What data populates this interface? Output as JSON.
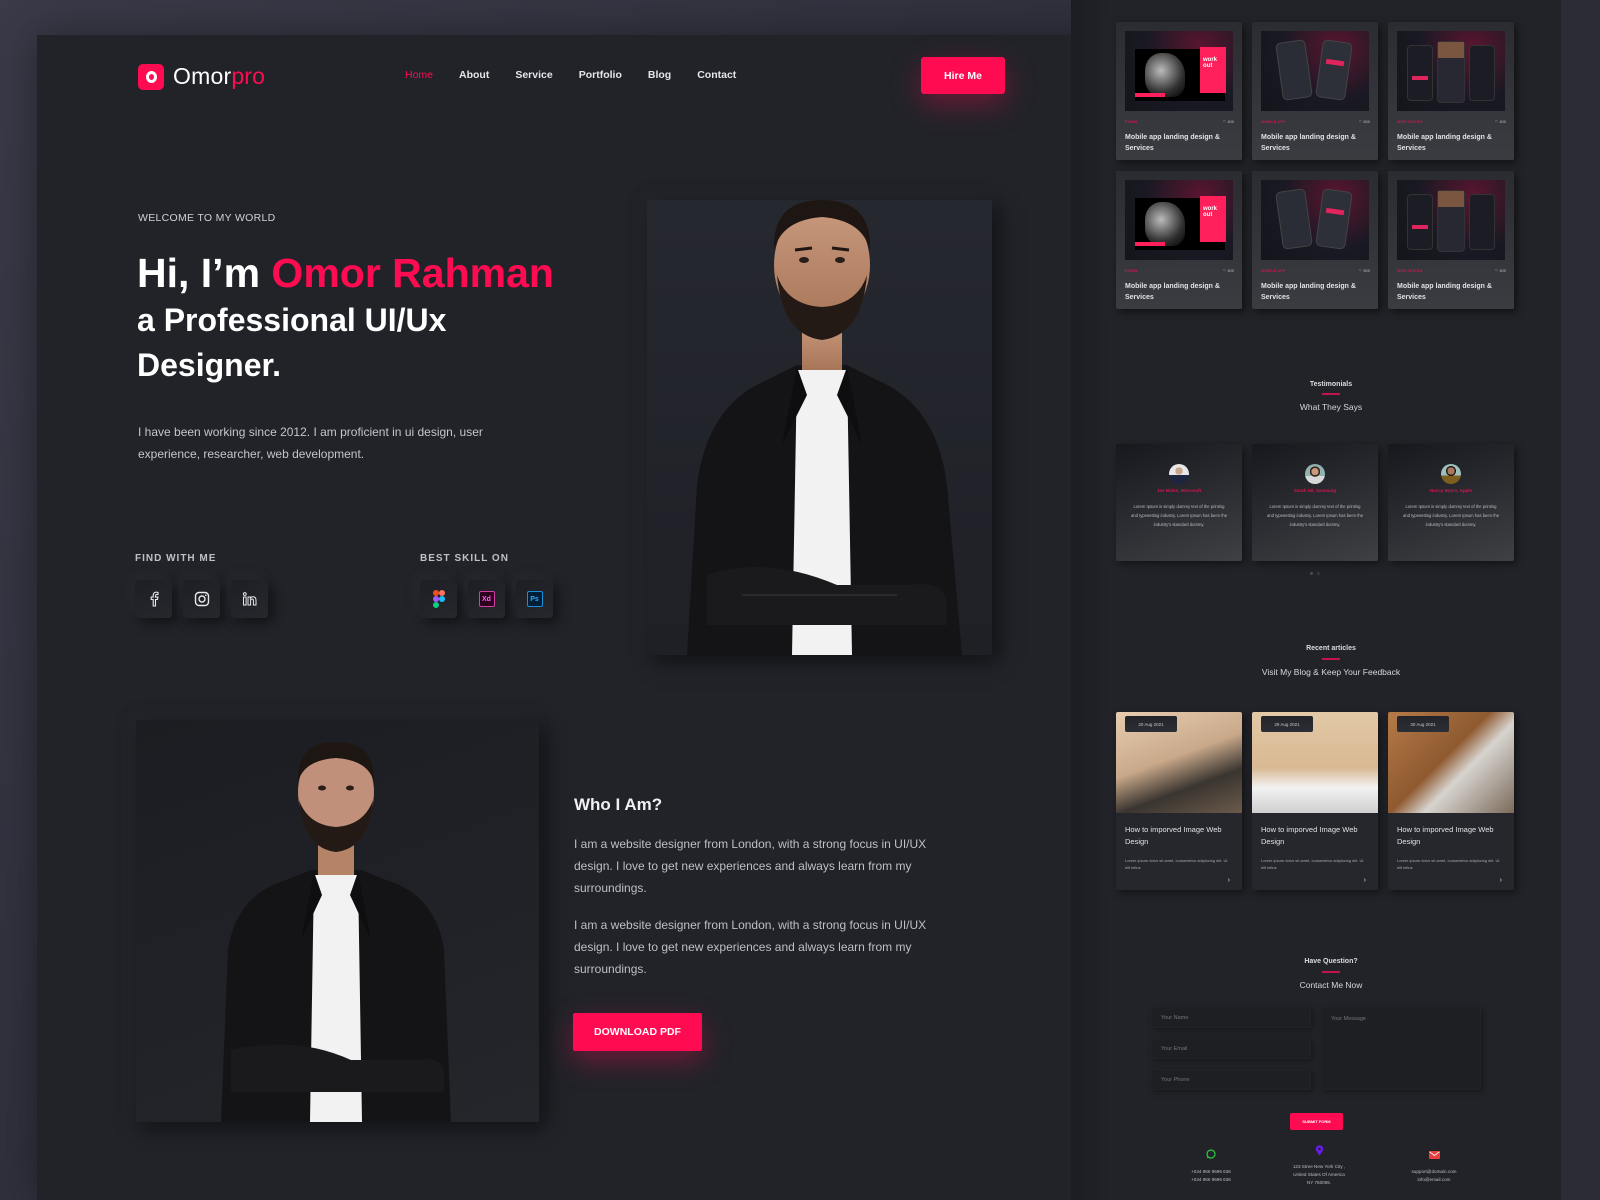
{
  "colors": {
    "accent": "#ff0b52",
    "bg": "#212329",
    "text": "#ffffff",
    "muted": "#c5c5cc"
  },
  "nav": {
    "logo_main": "Omor",
    "logo_accent": "pro",
    "items": [
      {
        "label": "Home",
        "active": true
      },
      {
        "label": "About",
        "active": false
      },
      {
        "label": "Service",
        "active": false
      },
      {
        "label": "Portfolio",
        "active": false
      },
      {
        "label": "Blog",
        "active": false
      },
      {
        "label": "Contact",
        "active": false
      }
    ],
    "hire_label": "Hire Me"
  },
  "hero": {
    "welcome": "WELCOME TO MY WORLD",
    "greeting": "Hi, I’m ",
    "name": "Omor Rahman",
    "role_line1": "a Professional UI/Ux",
    "role_line2": "Designer.",
    "description": "I have been working since 2012. I am proficient in ui design, user experience, researcher, web development.",
    "find_label": "FIND WITH ME",
    "skill_label": "BEST SKILL ON",
    "social": [
      {
        "icon": "facebook-icon"
      },
      {
        "icon": "instagram-icon"
      },
      {
        "icon": "linkedin-icon"
      }
    ],
    "skills": [
      {
        "icon": "figma-icon"
      },
      {
        "icon": "adobe-xd-icon",
        "text": "Xd"
      },
      {
        "icon": "photoshop-icon",
        "text": "Ps"
      }
    ]
  },
  "about": {
    "title": "Who I Am?",
    "paragraphs": [
      "I am a website designer from London, with a strong focus in UI/UX design. I love to get new experiences and always learn from my surroundings.",
      "I am a website designer from London, with a strong focus in UI/UX design. I love to get new experiences and always learn from my surroundings."
    ],
    "download_label": "DOWNLOAD PDF"
  },
  "portfolio": {
    "items": [
      {
        "category": "FIGMA",
        "likes": "400",
        "title": "Mobile app landing design & Services",
        "thumb": "workout"
      },
      {
        "category": "MOBILE APP",
        "likes": "500",
        "title": "Mobile app landing design & Services",
        "thumb": "phones"
      },
      {
        "category": "WEB DESIGN",
        "likes": "400",
        "title": "Mobile app landing design & Services",
        "thumb": "food"
      },
      {
        "category": "FIGMA",
        "likes": "400",
        "title": "Mobile app landing design & Services",
        "thumb": "workout"
      },
      {
        "category": "MOBILE APP",
        "likes": "500",
        "title": "Mobile app landing design & Services",
        "thumb": "phones"
      },
      {
        "category": "WEB DESIGN",
        "likes": "400",
        "title": "Mobile app landing design & Services",
        "thumb": "food"
      }
    ],
    "workout_text": "work out"
  },
  "testimonials": {
    "kicker": "Testimonials",
    "title": "What They Says",
    "items": [
      {
        "name": "Joe Biden, Microsoft",
        "text": "Lorem Ipsum is simply dummy text of the printing and typesetting industry. Lorem Ipsum has been the industry's standard dummy."
      },
      {
        "name": "Sarah Nil, Samsung",
        "text": "Lorem Ipsum is simply dummy text of the printing and typesetting industry. Lorem Ipsum has been the industry's standard dummy."
      },
      {
        "name": "Nancy Byers, Apple",
        "text": "Lorem Ipsum is simply dummy text of the printing and typesetting industry. Lorem Ipsum has been the industry's standard dummy."
      }
    ]
  },
  "blog": {
    "kicker": "Recent articles",
    "title": "Visit My Blog & Keep Your Feedback",
    "items": [
      {
        "date": "20 Aug 2021",
        "title": "How to imporved Image Web Design",
        "desc": "Lorem ipsum dolor sit amet, consectetur adipiscing elit. Ut elit tellus"
      },
      {
        "date": "29 Aug 2021",
        "title": "How to imporved Image Web Design",
        "desc": "Lorem ipsum dolor sit amet, consectetur adipiscing elit. Ut elit tellus"
      },
      {
        "date": "30 Aug 2021",
        "title": "How to imporved Image Web Design",
        "desc": "Lorem ipsum dolor sit amet, consectetur adipiscing elit. Ut elit tellus"
      }
    ]
  },
  "contact": {
    "kicker": "Have Question?",
    "title": "Contact Me Now",
    "name_placeholder": "Your Name",
    "email_placeholder": "Your Email",
    "phone_placeholder": "Your Phone",
    "message_placeholder": "Your Message",
    "submit_label": "SUBMIT FORM",
    "phone_lines": [
      "+044 966 9696 636",
      "+044 966 9696 636"
    ],
    "address_lines": [
      "123 Stree New York City ,",
      "United States Of America",
      "NY 750065."
    ],
    "email_lines": [
      "support@domain.com",
      "info@email.com"
    ]
  }
}
